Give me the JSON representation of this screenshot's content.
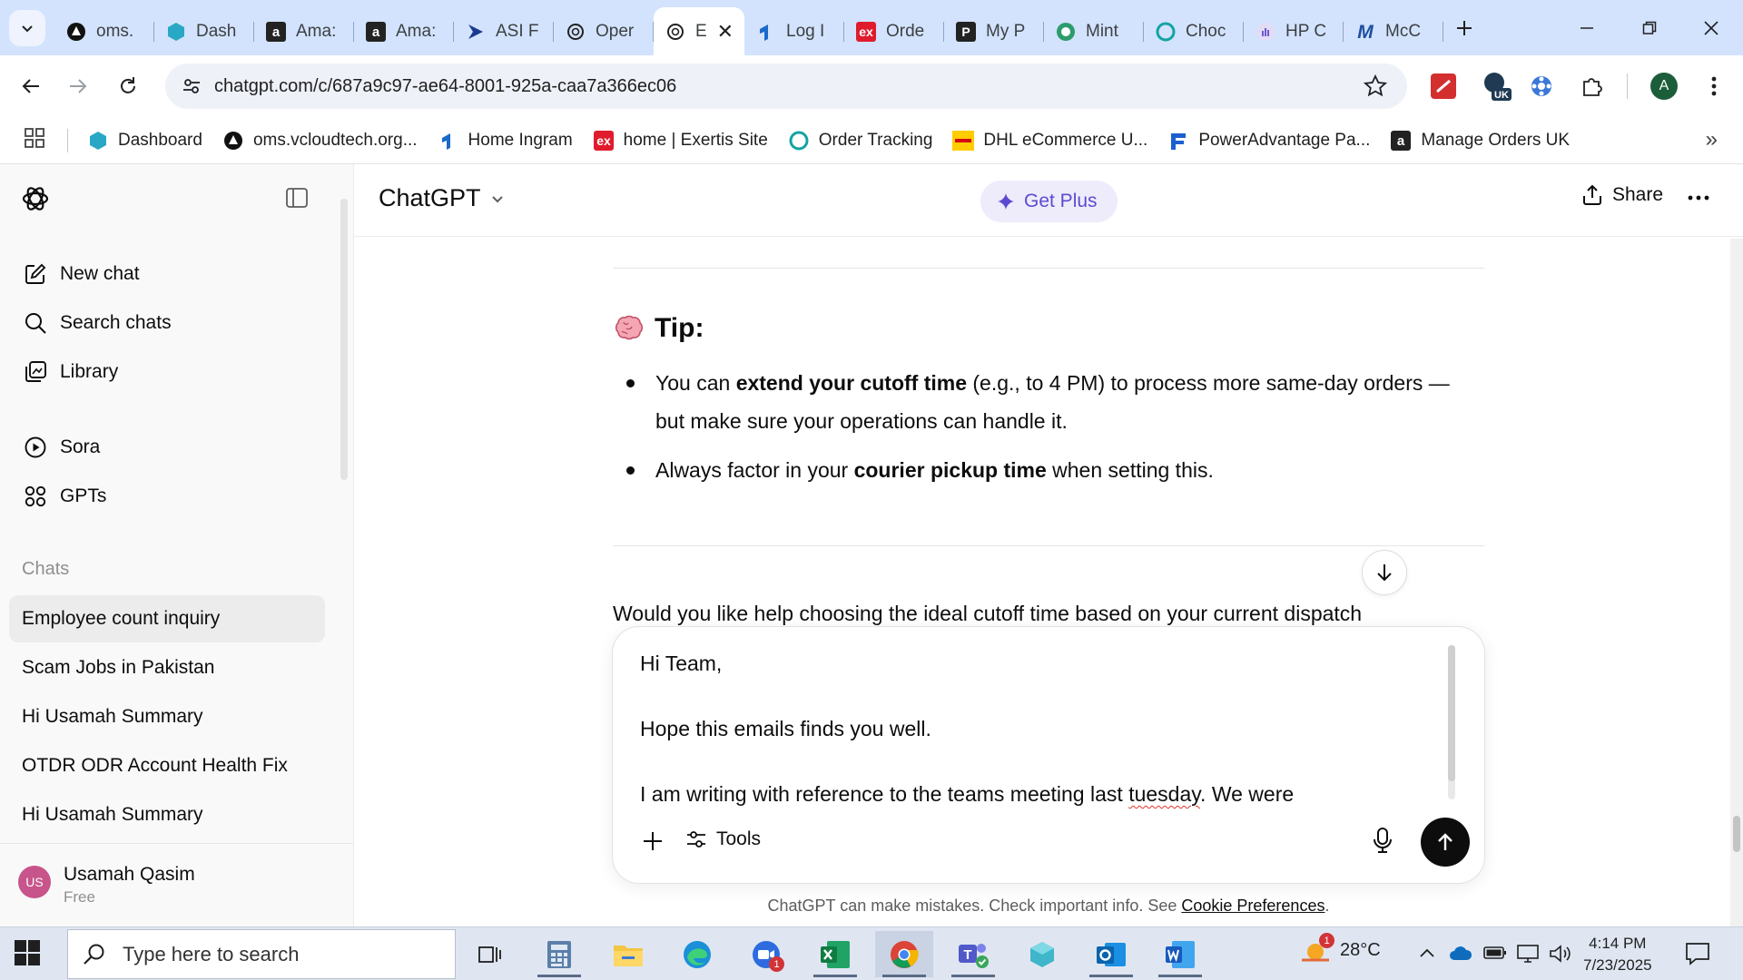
{
  "browser": {
    "tabs": [
      {
        "title": "oms.",
        "icon": "vcloud-icon"
      },
      {
        "title": "Dash",
        "icon": "dashboard-icon"
      },
      {
        "title": "Ama:",
        "icon": "amazon-icon"
      },
      {
        "title": "Ama:",
        "icon": "amazon-icon"
      },
      {
        "title": "ASI F",
        "icon": "asi-icon"
      },
      {
        "title": "Oper",
        "icon": "openai-icon"
      },
      {
        "title": "E",
        "icon": "openai-icon",
        "active": true
      },
      {
        "title": "Log I",
        "icon": "ingram-icon"
      },
      {
        "title": "Orde",
        "icon": "exertis-icon"
      },
      {
        "title": "My P",
        "icon": "pdf-icon"
      },
      {
        "title": "Mint",
        "icon": "mint-icon"
      },
      {
        "title": "Choc",
        "icon": "choco-icon"
      },
      {
        "title": "HP C",
        "icon": "hp-icon"
      },
      {
        "title": "McC",
        "icon": "mccarthy-icon"
      }
    ],
    "url": "chatgpt.com/c/687a9c97-ae64-8001-925a-caa7a366ec06",
    "profile_initial": "A",
    "ext_badge": "UK",
    "bookmarks": [
      {
        "label": "Dashboard",
        "icon": "dashboard-icon"
      },
      {
        "label": "oms.vcloudtech.org...",
        "icon": "vcloud-icon"
      },
      {
        "label": "Home Ingram",
        "icon": "ingram-icon"
      },
      {
        "label": "home | Exertis Site",
        "icon": "exertis-icon"
      },
      {
        "label": "Order Tracking",
        "icon": "tracking-icon"
      },
      {
        "label": "DHL eCommerce U...",
        "icon": "dhl-icon"
      },
      {
        "label": "PowerAdvantage Pa...",
        "icon": "poweradvantage-icon"
      },
      {
        "label": "Manage Orders UK",
        "icon": "amazon-icon"
      }
    ]
  },
  "sidebar": {
    "nav": [
      {
        "label": "New chat",
        "icon": "compose-icon"
      },
      {
        "label": "Search chats",
        "icon": "search-icon"
      },
      {
        "label": "Library",
        "icon": "library-icon"
      },
      {
        "label": "Sora",
        "icon": "play-circle-icon"
      },
      {
        "label": "GPTs",
        "icon": "grid-icon"
      }
    ],
    "chats_heading": "Chats",
    "chats": [
      "Employee count inquiry",
      "Scam Jobs in Pakistan",
      "Hi Usamah Summary",
      "OTDR ODR Account Health Fix",
      "Hi Usamah Summary"
    ],
    "user": {
      "initials": "US",
      "name": "Usamah Qasim",
      "plan": "Free"
    }
  },
  "header": {
    "model": "ChatGPT",
    "get_plus": "Get Plus",
    "share": "Share"
  },
  "message": {
    "tip_heading": "Tip:",
    "bullet1_pre": "You can ",
    "bullet1_bold": "extend your cutoff time",
    "bullet1_post": " (e.g., to 4 PM) to process more same-day orders — but make sure your operations can handle it.",
    "bullet2_pre": "Always factor in your ",
    "bullet2_bold": "courier pickup time",
    "bullet2_post": " when setting this.",
    "partial_line": "Would you like help choosing the ideal cutoff time based on your current dispatch"
  },
  "composer": {
    "line1": "Hi Team,",
    "line2": "Hope this emails finds you well.",
    "line3_pre": "I am writing with reference to the teams meeting last ",
    "line3_misspelled": "tuesday",
    "line3_post": ". We were",
    "tools_label": "Tools"
  },
  "disclaimer": {
    "text": "ChatGPT can make mistakes. Check important info. See ",
    "link": "Cookie Preferences",
    "end": "."
  },
  "taskbar": {
    "search_placeholder": "Type here to search",
    "zoom_badge": "1",
    "weather_badge": "1",
    "temperature": "28°C",
    "time": "4:14 PM",
    "date": "7/23/2025"
  },
  "colors": {
    "tabstrip": "#d3e3fd",
    "accent_plus": "#5b4bd0",
    "user_avatar": "#c7548a",
    "taskbar": "#dfe6f2"
  }
}
